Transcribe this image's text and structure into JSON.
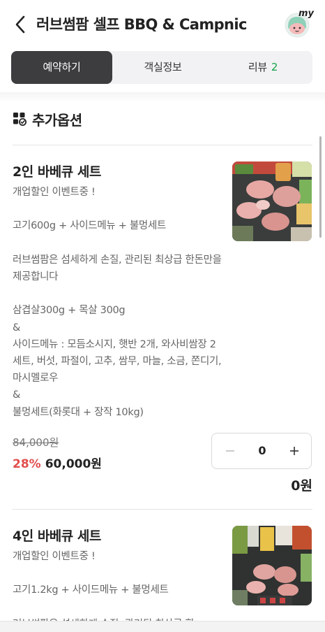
{
  "header": {
    "title": "러브썸팜 셀프 BBQ & Campnic",
    "back_icon": "chevron-left-icon",
    "avatar_label": "my"
  },
  "tabs": {
    "reserve": "예약하기",
    "room_info": "객실정보",
    "review": "리뷰",
    "review_count": "2"
  },
  "section": {
    "title": "추가옵션",
    "icon": "options-icon"
  },
  "products": [
    {
      "name": "2인 바베큐 세트",
      "description": "개업할인 이벤트중 !\n\n고기600g + 사이드메뉴 + 불멍세트\n\n러브썸팜은 섬세하게 손질, 관리된 최상급 한돈만을 제공합니다\n\n삼겹살300g + 목살 300g\n&\n사이드메뉴 : 모듬소시지, 햇반 2개, 와사비쌈장 2세트, 버섯, 파절이, 고추, 쌈무, 마늘, 소금, 쫀디기, 마시멜로우\n&\n불멍세트(화롯대 + 장작 10kg)",
      "original_price": "84,000원",
      "discount": "28%",
      "price": "60,000원",
      "quantity": "0",
      "total": "0원"
    },
    {
      "name": "4인 바베큐 세트",
      "description": "개업할인 이벤트중 !\n\n고기1.2kg + 사이드메뉴 + 불멍세트\n\n러브썸팜은 섬세하게 손질, 관리된 최상급 한"
    }
  ],
  "colors": {
    "active_tab": "#3d3d40",
    "review_count": "#16a34a",
    "discount": "#e24d4d"
  }
}
